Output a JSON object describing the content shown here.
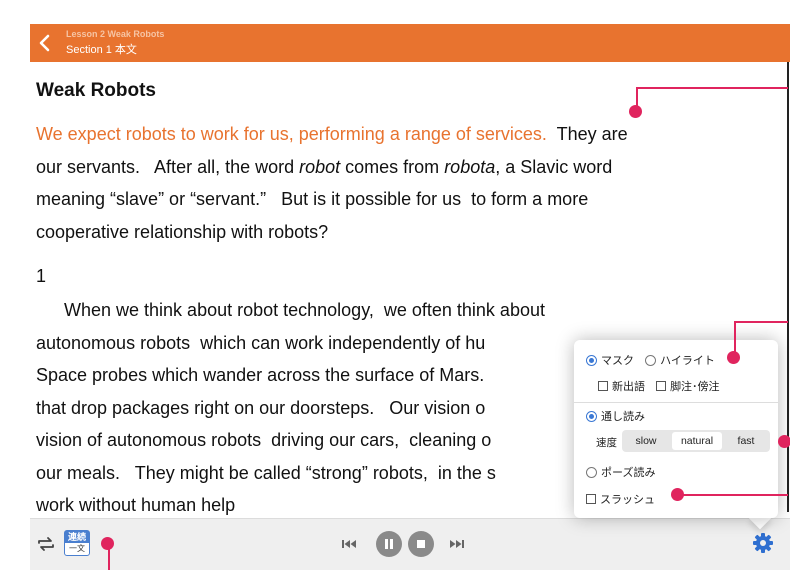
{
  "header": {
    "lesson": "Lesson 2  Weak Robots",
    "section": "Section 1  本文"
  },
  "content": {
    "title": "Weak Robots",
    "p1": {
      "highlight": "We expect robots to work for us, performing a range of services.",
      "l1_rest": "  They are",
      "l2_a": "our servants.   After all, the word ",
      "l2_robot": "robot",
      "l2_b": " comes from ",
      "l2_robota": "robota",
      "l2_c": ", a Slavic word",
      "l3": "meaning “slave” or “servant.”   But is it possible for us  to form a more",
      "l4": "cooperative relationship with robots?"
    },
    "para_number": "1",
    "p2": {
      "l1": "When we think about robot technology,  we often think about",
      "l2": "autonomous robots  which can work independently of hu",
      "l3": "Space probes which wander across the surface of Mars.",
      "l4": "that drop packages right on our doorsteps.   Our vision o",
      "l5": "vision of autonomous robots  driving our cars,  cleaning o",
      "l6": "our meals.   They might be called “strong” robots,  in the s",
      "l7": "work without human help"
    }
  },
  "settings": {
    "display_mode": {
      "mask": "マスク",
      "highlight": "ハイライト",
      "selected": "mask"
    },
    "options": {
      "new_words": "新出語",
      "notes": "脚注･傍注"
    },
    "continuous": "通し読み",
    "speed_label": "速度",
    "speeds": [
      "slow",
      "natural",
      "fast"
    ],
    "speed_selected": "natural",
    "pause_reading": "ポーズ読み",
    "slash": "スラッシュ"
  },
  "player": {
    "mode_top": "連続",
    "mode_bottom": "一文"
  },
  "colors": {
    "accent": "#e8732f",
    "callout": "#e0245e",
    "radio_selected": "#3a78d4"
  }
}
